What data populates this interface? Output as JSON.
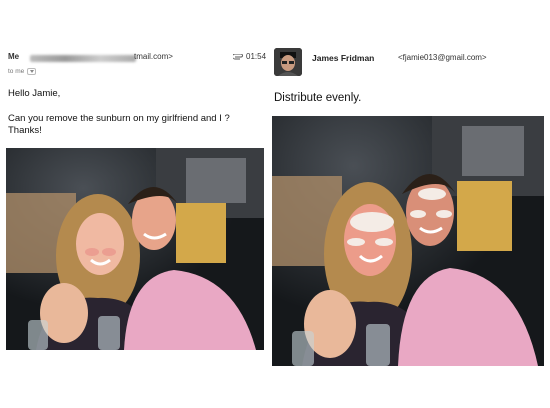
{
  "left_email": {
    "sender_name": "Me",
    "sender_email_suffix": "tmail.com>",
    "time": "01:54",
    "recipient": "to me",
    "greeting": "Hello Jamie,",
    "body_line1": "Can you remove the sunburn on my girlfriend and I ?",
    "body_line2": "Thanks!",
    "attachment_icon": "paperclip-icon"
  },
  "reply": {
    "sender_name": "James Fridman",
    "sender_email": "<fjamie013@gmail.com>",
    "message": "Distribute evenly.",
    "avatar_icon": "avatar-photo"
  },
  "photos": {
    "original": "couple-photo-original",
    "edited": "couple-photo-edited"
  }
}
